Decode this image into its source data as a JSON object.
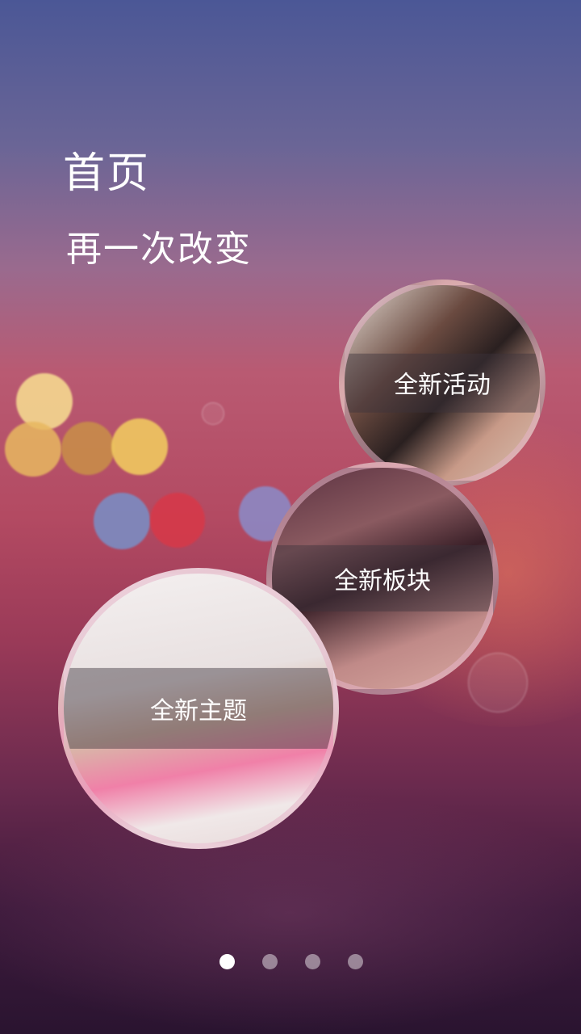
{
  "header": {
    "title": "首页",
    "subtitle": "再一次改变"
  },
  "features": [
    {
      "label": "全新活动"
    },
    {
      "label": "全新板块"
    },
    {
      "label": "全新主题"
    }
  ],
  "pager": {
    "total": 4,
    "active": 1
  },
  "colors": {
    "accent": "#ffffff",
    "ring": "#e6b4c8"
  }
}
